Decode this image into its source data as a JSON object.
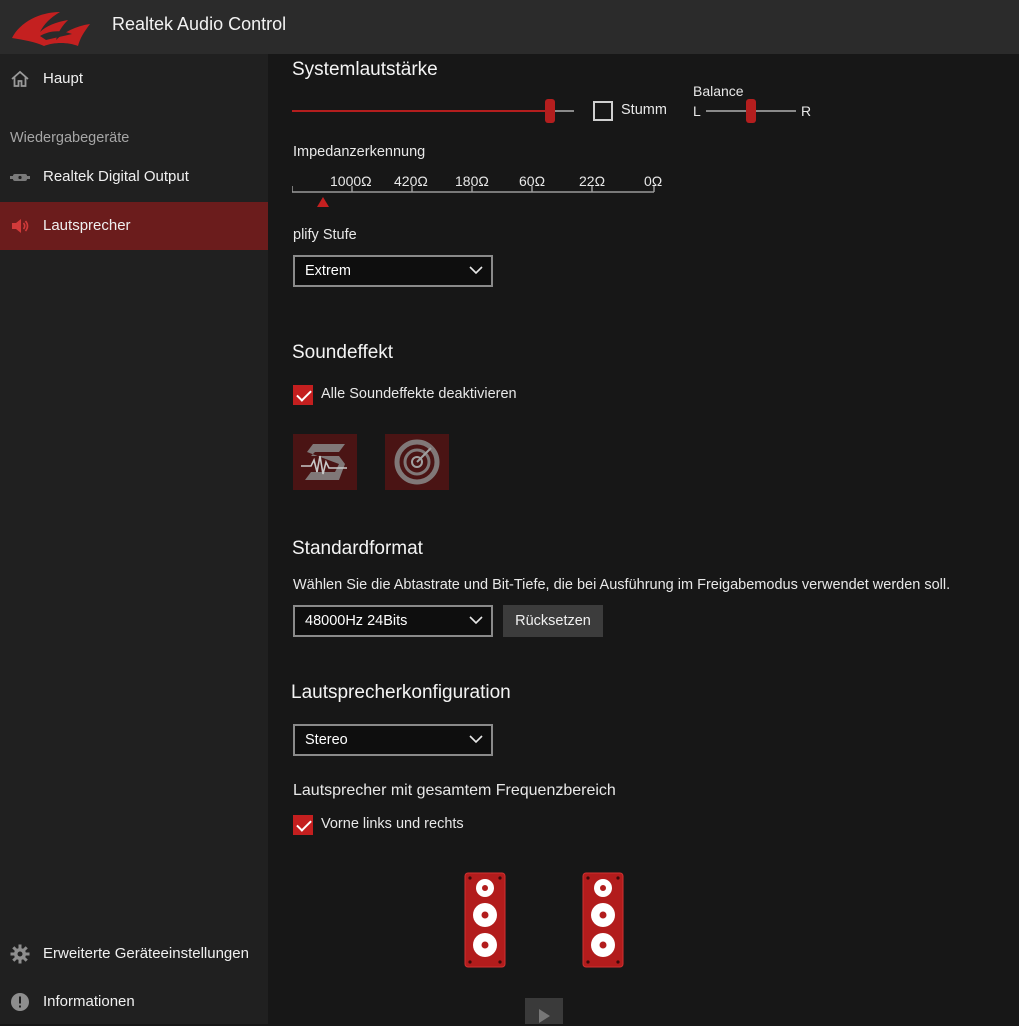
{
  "app": {
    "title": "Realtek Audio Control"
  },
  "sidebar": {
    "section_label": "Wiedergabegeräte",
    "items": [
      {
        "label": "Haupt",
        "icon": "home-icon"
      },
      {
        "label": "Realtek Digital Output",
        "icon": "digital-output-icon"
      },
      {
        "label": "Lautsprecher",
        "icon": "speaker-icon",
        "active": true
      },
      {
        "label": "Erweiterte Geräteeinstellungen",
        "icon": "gear-icon"
      },
      {
        "label": "Informationen",
        "icon": "info-icon"
      }
    ]
  },
  "volume": {
    "title": "Systemlautstärke",
    "level": 0.92,
    "mute_label": "Stumm",
    "mute_checked": false,
    "balance_label": "Balance",
    "balance_left": "L",
    "balance_right": "R",
    "balance_value": 0.5
  },
  "impedance": {
    "title": "Impedanzerkennung",
    "ticks": [
      "1000Ω",
      "420Ω",
      "180Ω",
      "60Ω",
      "22Ω",
      "0Ω"
    ]
  },
  "amplify": {
    "label": "plify Stufe",
    "selected": "Extrem"
  },
  "soundeffect": {
    "title": "Soundeffekt",
    "disable_label": "Alle Soundeffekte deaktivieren",
    "disable_checked": true,
    "effects": [
      "sonic-studio-icon",
      "sonic-radar-icon"
    ]
  },
  "format": {
    "title": "Standardformat",
    "description": "Wählen Sie die Abtastrate und Bit-Tiefe, die bei Ausführung im Freigabemodus verwendet werden soll.",
    "selected": "48000Hz 24Bits",
    "reset_label": "Rücksetzen"
  },
  "speaker_config": {
    "title": "Lautsprecherkonfiguration",
    "selected": "Stereo",
    "fullrange_title": "Lautsprecher mit gesamtem Frequenzbereich",
    "front_label": "Vorne links und rechts",
    "front_checked": true
  },
  "colors": {
    "accent": "#b41e1e",
    "active_nav": "#6b1c1c",
    "background": "#171717",
    "sidebar": "#202020"
  }
}
